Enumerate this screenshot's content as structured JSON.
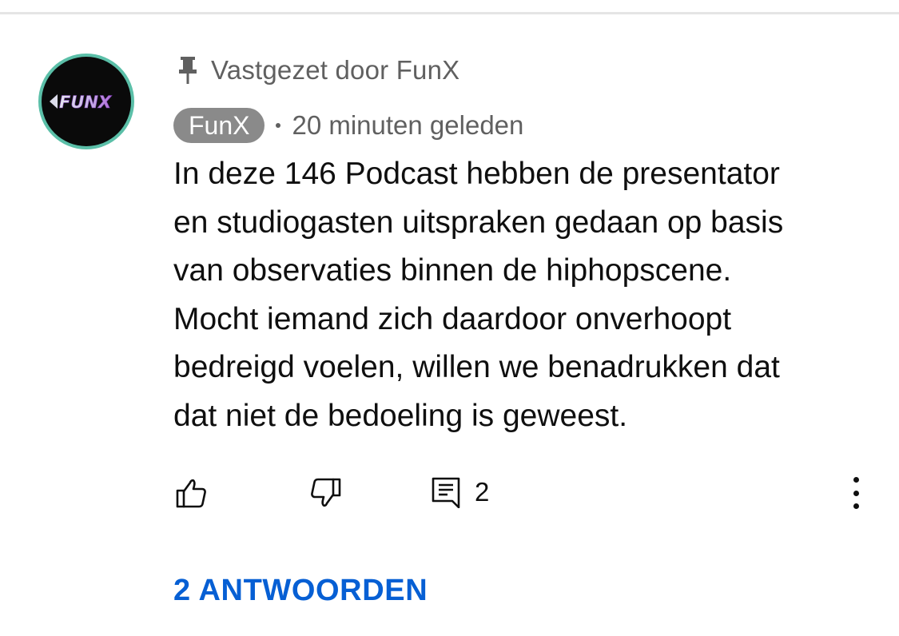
{
  "comment": {
    "pinned_label": "Vastgezet door FunX",
    "author": "FunX",
    "avatar_logo_text": "FUNX",
    "timestamp": "20 minuten geleden",
    "body_lines": [
      "In deze 146 Podcast hebben de presentator",
      "en studiogasten uitspraken gedaan op basis",
      "van observaties binnen de hiphopscene.",
      "Mocht iemand zich daardoor onverhoopt",
      "bedreigd voelen, willen we benadrukken dat",
      "dat niet de bedoeling is geweest."
    ],
    "actions": {
      "like_icon": "thumbs-up-icon",
      "dislike_icon": "thumbs-down-icon",
      "reply_icon": "comment-reply-icon",
      "reply_count": "2",
      "more_icon": "more-vertical-icon"
    },
    "replies_link": "2 ANTWOORDEN"
  },
  "colors": {
    "text_primary": "#0f0f0f",
    "text_secondary": "#606060",
    "author_badge_bg": "#8a8a8a",
    "link_blue": "#065fd4",
    "avatar_ring": "#5bbfa8",
    "avatar_bg": "#0a0a0a",
    "divider": "#e5e5e5"
  }
}
